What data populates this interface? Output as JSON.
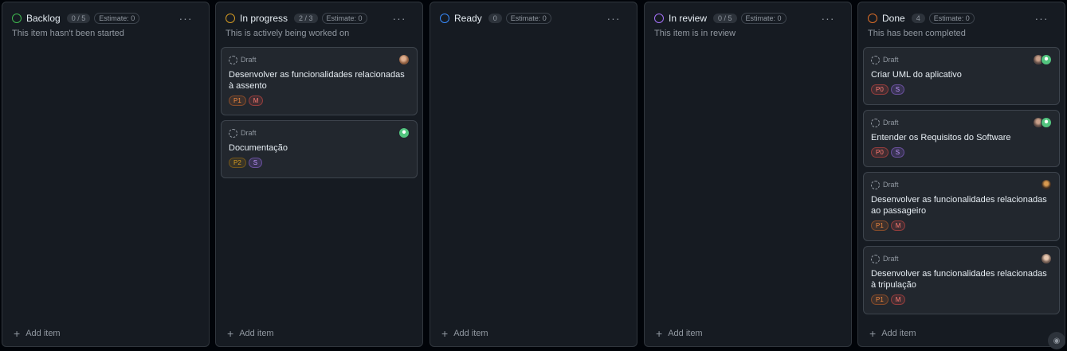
{
  "columns": [
    {
      "title": "Backlog",
      "count": "0 / 5",
      "estimate": "Estimate: 0",
      "description": "This item hasn't been started",
      "color": "#3fb950",
      "add_label": "Add item",
      "cards": []
    },
    {
      "title": "In progress",
      "count": "2 / 3",
      "estimate": "Estimate: 0",
      "description": "This is actively being worked on",
      "color": "#d29922",
      "add_label": "Add item",
      "cards": [
        {
          "draft": "Draft",
          "title": "Desenvolver as funcionalidades relacionadas à assento",
          "labels": [
            {
              "text": "P1",
              "kind": "p1"
            },
            {
              "text": "M",
              "kind": "m"
            }
          ],
          "avatars": [
            "photo1"
          ]
        },
        {
          "draft": "Draft",
          "title": "Documentação",
          "labels": [
            {
              "text": "P2",
              "kind": "p2"
            },
            {
              "text": "S",
              "kind": "s"
            }
          ],
          "avatars": [
            "green"
          ]
        }
      ]
    },
    {
      "title": "Ready",
      "count": "0",
      "estimate": "Estimate: 0",
      "description": "",
      "color": "#388bfd",
      "add_label": "Add item",
      "cards": []
    },
    {
      "title": "In review",
      "count": "0 / 5",
      "estimate": "Estimate: 0",
      "description": "This item is in review",
      "color": "#a371f7",
      "add_label": "Add item",
      "cards": []
    },
    {
      "title": "Done",
      "count": "4",
      "estimate": "Estimate: 0",
      "description": "This has been completed",
      "color": "#db6d28",
      "add_label": "Add item",
      "cards": [
        {
          "draft": "Draft",
          "title": "Criar UML do aplicativo",
          "labels": [
            {
              "text": "P0",
              "kind": "p0"
            },
            {
              "text": "S",
              "kind": "s"
            }
          ],
          "avatars": [
            "photo2",
            "green"
          ]
        },
        {
          "draft": "Draft",
          "title": "Entender os Requisitos do Software",
          "labels": [
            {
              "text": "P0",
              "kind": "p0"
            },
            {
              "text": "S",
              "kind": "s"
            }
          ],
          "avatars": [
            "photo2",
            "green"
          ]
        },
        {
          "draft": "Draft",
          "title": "Desenvolver as funcionalidades relacionadas ao passageiro",
          "labels": [
            {
              "text": "P1",
              "kind": "p1"
            },
            {
              "text": "M",
              "kind": "m"
            }
          ],
          "avatars": [
            "photo3"
          ]
        },
        {
          "draft": "Draft",
          "title": "Desenvolver as funcionalidades relacionadas à tripulação",
          "labels": [
            {
              "text": "P1",
              "kind": "p1"
            },
            {
              "text": "M",
              "kind": "m"
            }
          ],
          "avatars": [
            "photo4"
          ]
        }
      ]
    }
  ],
  "icons": {
    "column_menu": "kebab-horizontal-icon",
    "add": "plus-icon",
    "draft": "draft-circle-icon",
    "corner": "copilot-icon"
  }
}
